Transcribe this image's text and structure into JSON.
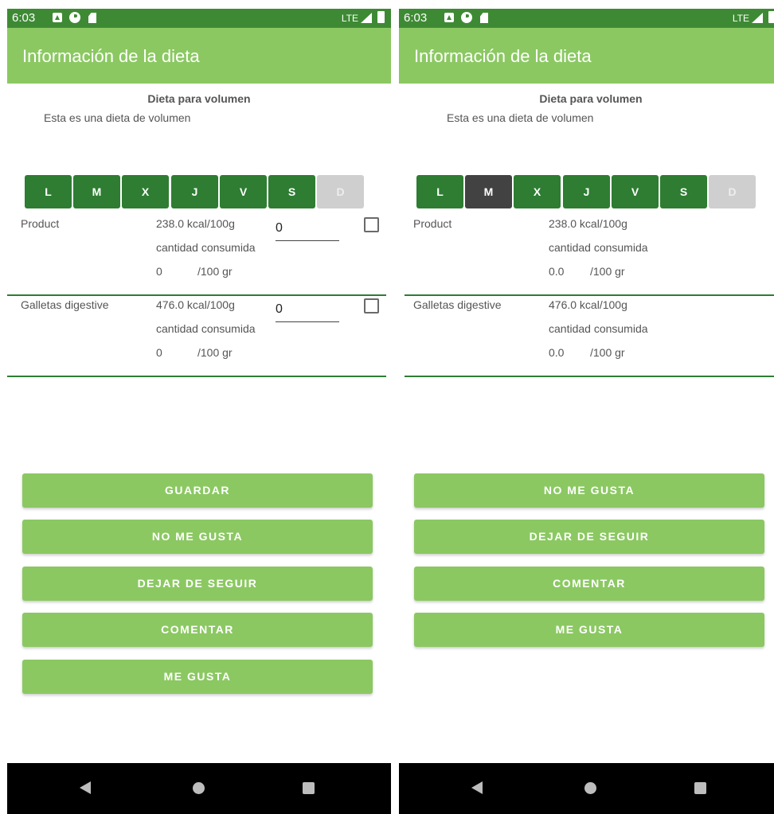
{
  "screens": {
    "left": {
      "status": {
        "time": "6:03",
        "network": "LTE"
      },
      "app_title": "Información de la dieta",
      "diet_name": "Dieta para volumen",
      "diet_description": "Esta es una dieta de volumen",
      "days": [
        "L",
        "M",
        "X",
        "J",
        "V",
        "S",
        "D"
      ],
      "selected_day": null,
      "disabled_days": [
        "D"
      ],
      "foods": [
        {
          "name": "Product",
          "kcal": "238.0 kcal/100g",
          "consumed_label": "cantidad consumida",
          "amount": "0",
          "unit": "/100 gr",
          "input_value": "0",
          "checked": false
        },
        {
          "name": "Galletas digestive",
          "kcal": "476.0 kcal/100g",
          "consumed_label": "cantidad consumida",
          "amount": "0",
          "unit": "/100 gr",
          "input_value": "0",
          "checked": false
        }
      ],
      "buttons": [
        "GUARDAR",
        "NO ME GUSTA",
        "DEJAR DE SEGUIR",
        "COMENTAR",
        "ME GUSTA"
      ]
    },
    "right": {
      "status": {
        "time": "6:03",
        "network": "LTE"
      },
      "app_title": "Información de la dieta",
      "diet_name": "Dieta para volumen",
      "diet_description": "Esta es una dieta de volumen",
      "days": [
        "L",
        "M",
        "X",
        "J",
        "V",
        "S",
        "D"
      ],
      "selected_day": "M",
      "disabled_days": [
        "D"
      ],
      "foods": [
        {
          "name": "Product",
          "kcal": "238.0 kcal/100g",
          "consumed_label": "cantidad consumida",
          "amount": "0.0",
          "unit": "/100 gr"
        },
        {
          "name": "Galletas digestive",
          "kcal": "476.0 kcal/100g",
          "consumed_label": "cantidad consumida",
          "amount": "0.0",
          "unit": "/100 gr"
        }
      ],
      "buttons": [
        "NO ME GUSTA",
        "DEJAR DE SEGUIR",
        "COMENTAR",
        "ME GUSTA"
      ]
    }
  },
  "colors": {
    "status_bar": "#3e8a34",
    "app_bar": "#8bc862",
    "day_button": "#2e7d32",
    "day_selected": "#424242",
    "day_disabled": "#cfcfcf",
    "action_button": "#8bc862",
    "nav_bar": "#000000"
  },
  "icons": [
    "sim-a-icon",
    "data-saver-icon",
    "sd-card-icon",
    "signal-icon",
    "battery-icon",
    "back-icon",
    "home-icon",
    "recents-icon"
  ]
}
